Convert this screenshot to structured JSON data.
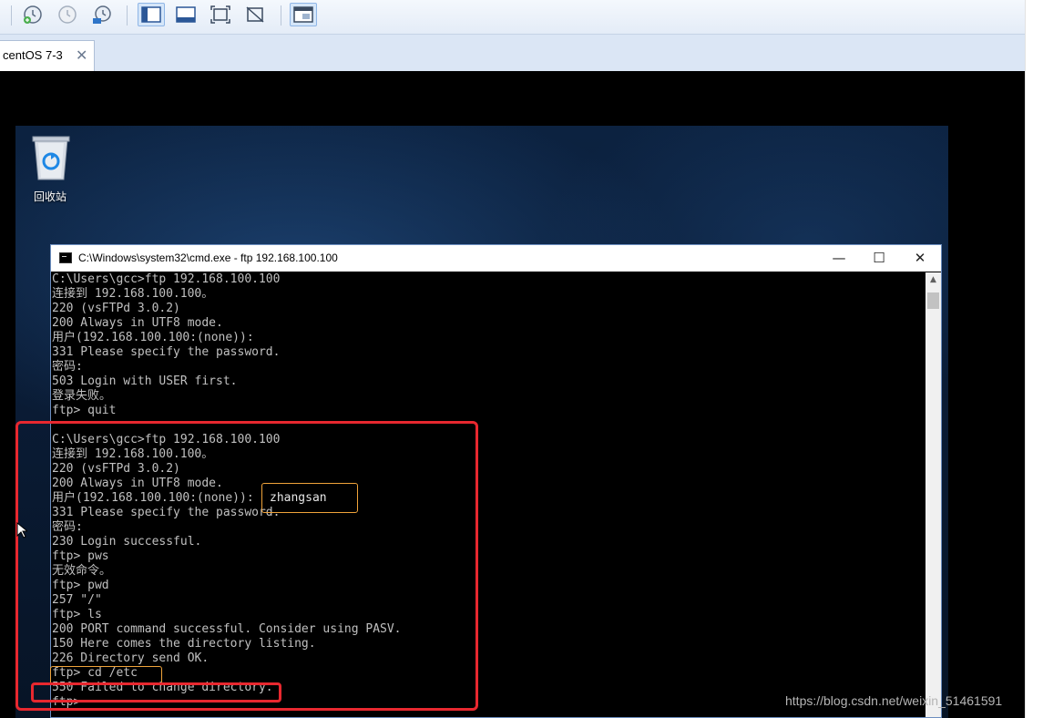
{
  "vm_tab": {
    "label": "centOS 7-3",
    "close_glyph": "✕"
  },
  "toolbar": {
    "icons": [
      "snapshot-take-icon",
      "snapshot-revert-icon",
      "snapshot-manager-icon",
      "console-view-icon",
      "fit-guest-icon",
      "full-screen-icon",
      "unity-icon",
      "thumbnail-view-icon"
    ]
  },
  "desktop": {
    "recycle_bin_label": "回收站"
  },
  "cmd": {
    "title": "C:\\Windows\\system32\\cmd.exe - ftp  192.168.100.100",
    "controls": {
      "minimize": "—",
      "maximize": "☐",
      "close": "✕"
    },
    "lines": [
      "C:\\Users\\gcc>ftp 192.168.100.100",
      "连接到 192.168.100.100。",
      "220 (vsFTPd 3.0.2)",
      "200 Always in UTF8 mode.",
      "用户(192.168.100.100:(none)):",
      "331 Please specify the password.",
      "密码:",
      "503 Login with USER first.",
      "登录失败。",
      "ftp> quit",
      "",
      "C:\\Users\\gcc>ftp 192.168.100.100",
      "连接到 192.168.100.100。",
      "220 (vsFTPd 3.0.2)",
      "200 Always in UTF8 mode.",
      "用户(192.168.100.100:(none)):",
      "331 Please specify the password.",
      "密码:",
      "230 Login successful.",
      "ftp> pws",
      "无效命令。",
      "ftp> pwd",
      "257 \"/\"",
      "ftp> ls",
      "200 PORT command successful. Consider using PASV.",
      "150 Here comes the directory listing.",
      "226 Directory send OK.",
      "ftp> cd /etc",
      "550 Failed to change directory.",
      "ftp>"
    ]
  },
  "annotations": {
    "username_box": "zhangsan"
  },
  "watermark": "https://blog.csdn.net/weixin_51461591",
  "colors": {
    "annotation_red": "#e8282f",
    "annotation_orange": "#f0a33a",
    "console_text": "#c0c0c0"
  }
}
